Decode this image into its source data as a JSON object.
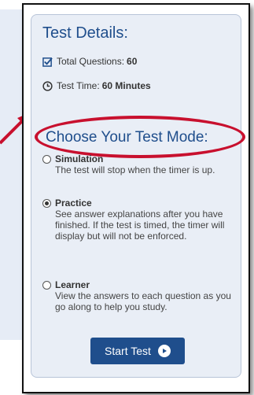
{
  "panel": {
    "title": "Test Details:",
    "details": [
      {
        "label": "Total Questions:",
        "value": "60",
        "icon": "checkbox-icon"
      },
      {
        "label": "Test Time:",
        "value": "60 Minutes",
        "icon": "clock-icon"
      }
    ],
    "mode_heading": "Choose Your Test Mode:",
    "modes": [
      {
        "name": "Simulation",
        "selected": false,
        "description": "The test will stop when the timer is up."
      },
      {
        "name": "Practice",
        "selected": true,
        "description": "See answer explanations after you have finished. If the test is timed, the timer will display but will not be enforced."
      },
      {
        "name": "Learner",
        "selected": false,
        "description": "View the answers to each question as you go along to help you study."
      }
    ],
    "start_button": "Start Test"
  },
  "colors": {
    "accent": "#1f4e8c",
    "highlight": "#c8102e",
    "panel_bg": "#e9eef6"
  }
}
